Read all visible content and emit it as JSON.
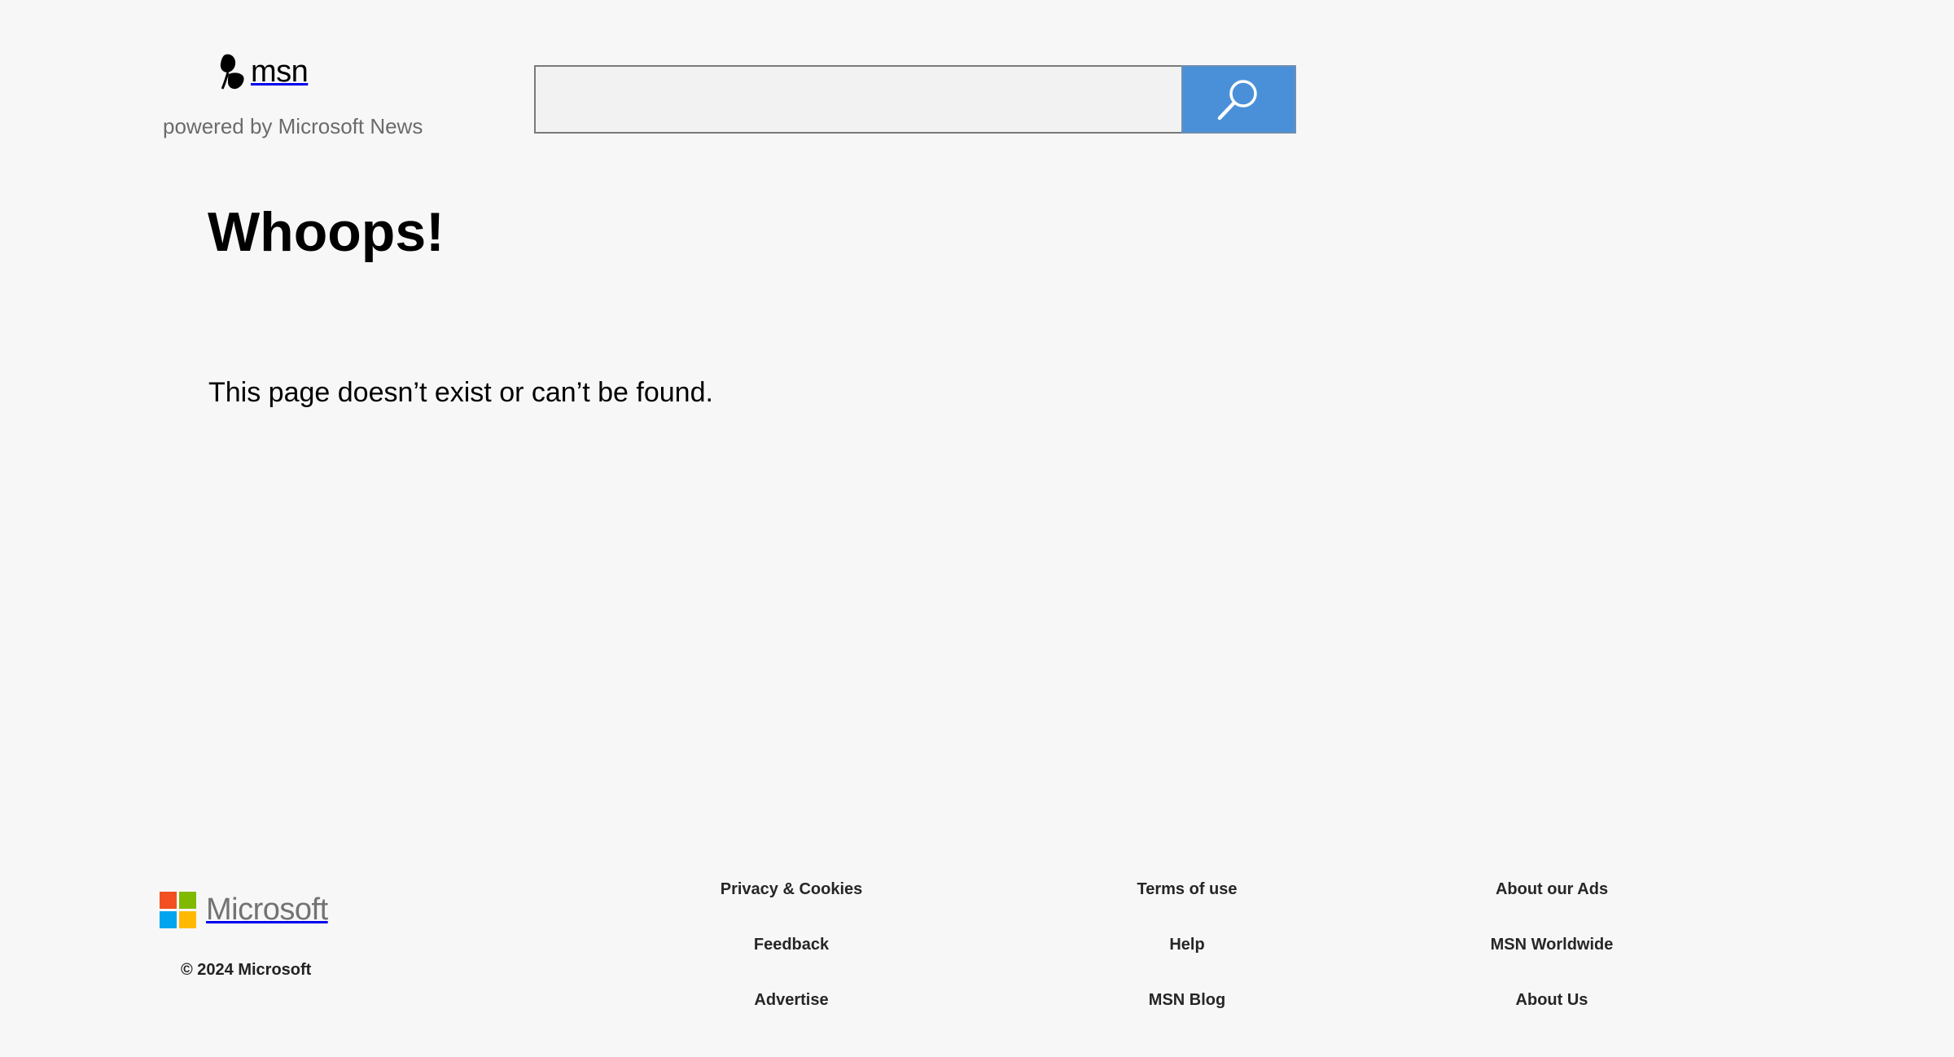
{
  "header": {
    "logo_text": "msn",
    "powered_by": "powered by Microsoft News"
  },
  "search": {
    "value": "",
    "placeholder": "",
    "button_icon": "search-icon",
    "button_color": "#4a90d9"
  },
  "main": {
    "heading": "Whoops!",
    "message": "This page doesn’t exist or can’t be found."
  },
  "footer": {
    "brand": "Microsoft",
    "brand_colors": [
      "#f25022",
      "#7fba00",
      "#00a4ef",
      "#ffb900"
    ],
    "copyright": "© 2024 Microsoft",
    "links": [
      {
        "label": "Privacy & Cookies"
      },
      {
        "label": "Terms of use"
      },
      {
        "label": "About our Ads"
      },
      {
        "label": "Feedback"
      },
      {
        "label": "Help"
      },
      {
        "label": "MSN Worldwide"
      },
      {
        "label": "Advertise"
      },
      {
        "label": "MSN Blog"
      },
      {
        "label": "About Us"
      }
    ]
  }
}
